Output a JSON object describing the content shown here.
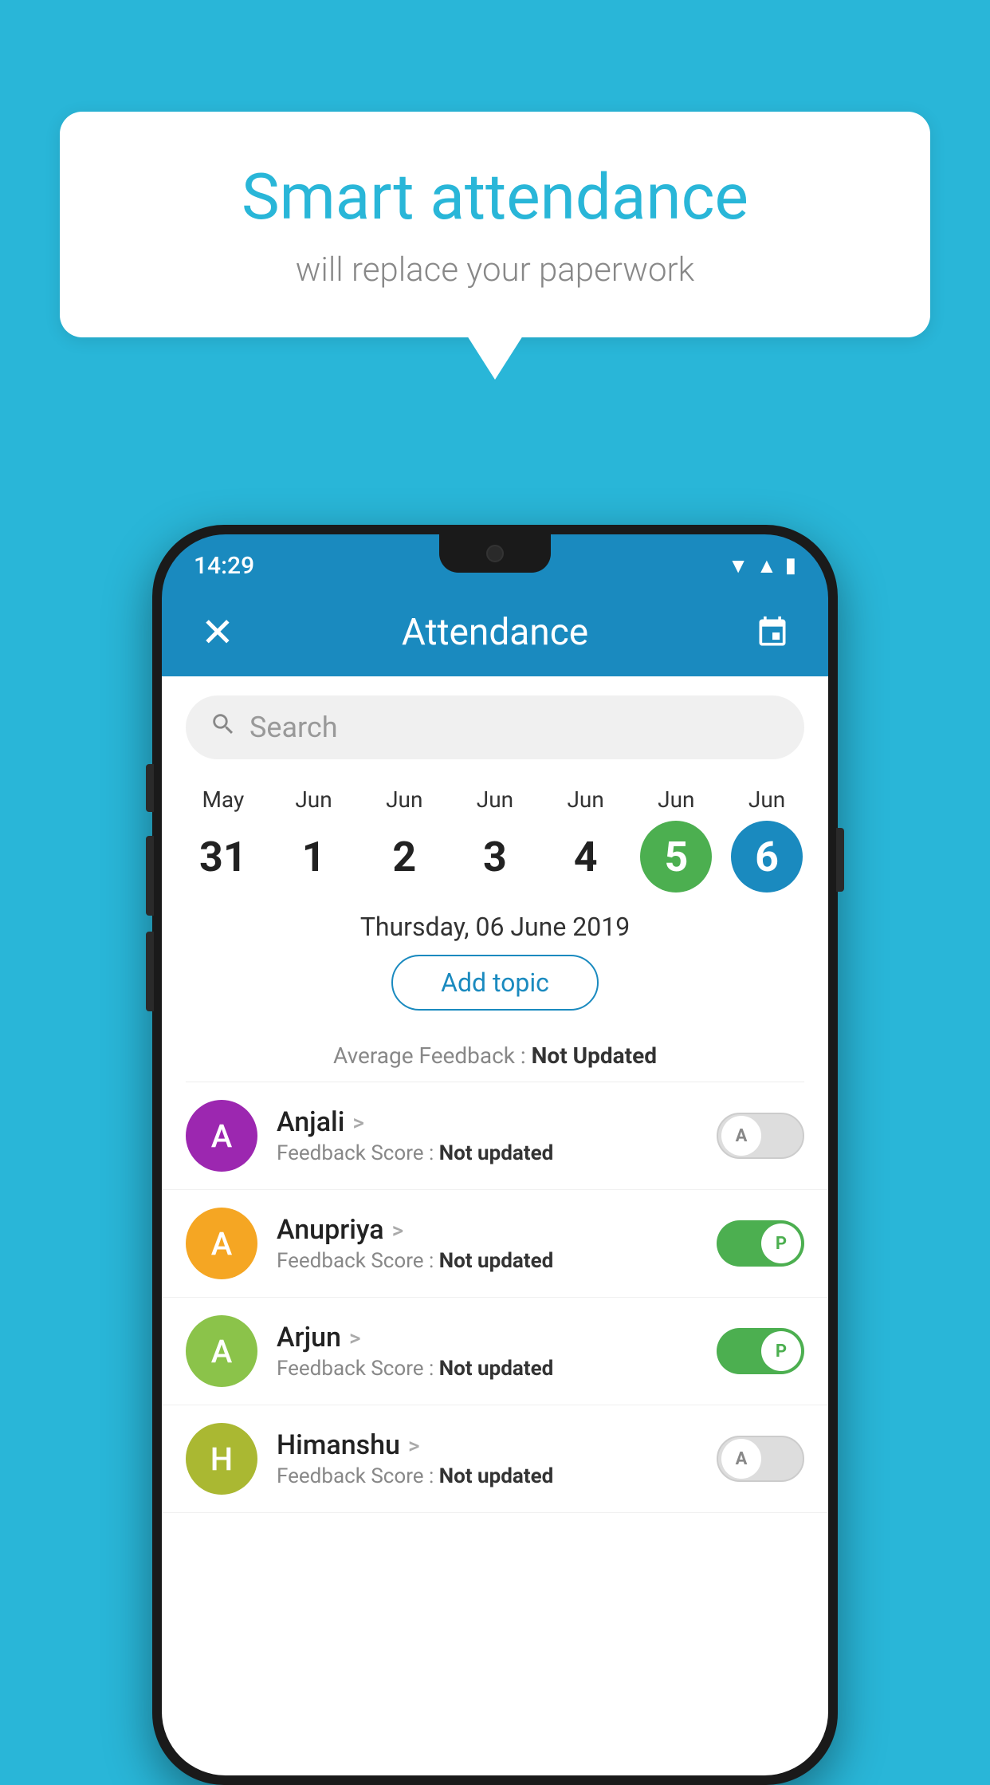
{
  "promo": {
    "title": "Smart attendance",
    "subtitle": "will replace your paperwork"
  },
  "status_bar": {
    "time": "14:29",
    "wifi_icon": "▼",
    "signal_icon": "◂",
    "battery_icon": "▮"
  },
  "app_bar": {
    "title": "Attendance",
    "close_label": "×",
    "calendar_icon": "📅"
  },
  "search": {
    "placeholder": "Search"
  },
  "calendar": {
    "days": [
      {
        "month": "May",
        "num": "31",
        "state": "normal"
      },
      {
        "month": "Jun",
        "num": "1",
        "state": "normal"
      },
      {
        "month": "Jun",
        "num": "2",
        "state": "normal"
      },
      {
        "month": "Jun",
        "num": "3",
        "state": "normal"
      },
      {
        "month": "Jun",
        "num": "4",
        "state": "normal"
      },
      {
        "month": "Jun",
        "num": "5",
        "state": "today"
      },
      {
        "month": "Jun",
        "num": "6",
        "state": "selected"
      }
    ]
  },
  "selected_date": "Thursday, 06 June 2019",
  "add_topic_label": "Add topic",
  "avg_feedback_label": "Average Feedback :",
  "avg_feedback_value": "Not Updated",
  "students": [
    {
      "name": "Anjali",
      "initial": "A",
      "color": "#9c27b0",
      "feedback_label": "Feedback Score :",
      "feedback_value": "Not updated",
      "attendance": "absent",
      "toggle_label": "A"
    },
    {
      "name": "Anupriya",
      "initial": "A",
      "color": "#f5a623",
      "feedback_label": "Feedback Score :",
      "feedback_value": "Not updated",
      "attendance": "present",
      "toggle_label": "P"
    },
    {
      "name": "Arjun",
      "initial": "A",
      "color": "#8bc34a",
      "feedback_label": "Feedback Score :",
      "feedback_value": "Not updated",
      "attendance": "present",
      "toggle_label": "P"
    },
    {
      "name": "Himanshu",
      "initial": "H",
      "color": "#aab832",
      "feedback_label": "Feedback Score :",
      "feedback_value": "Not updated",
      "attendance": "absent",
      "toggle_label": "A"
    }
  ]
}
